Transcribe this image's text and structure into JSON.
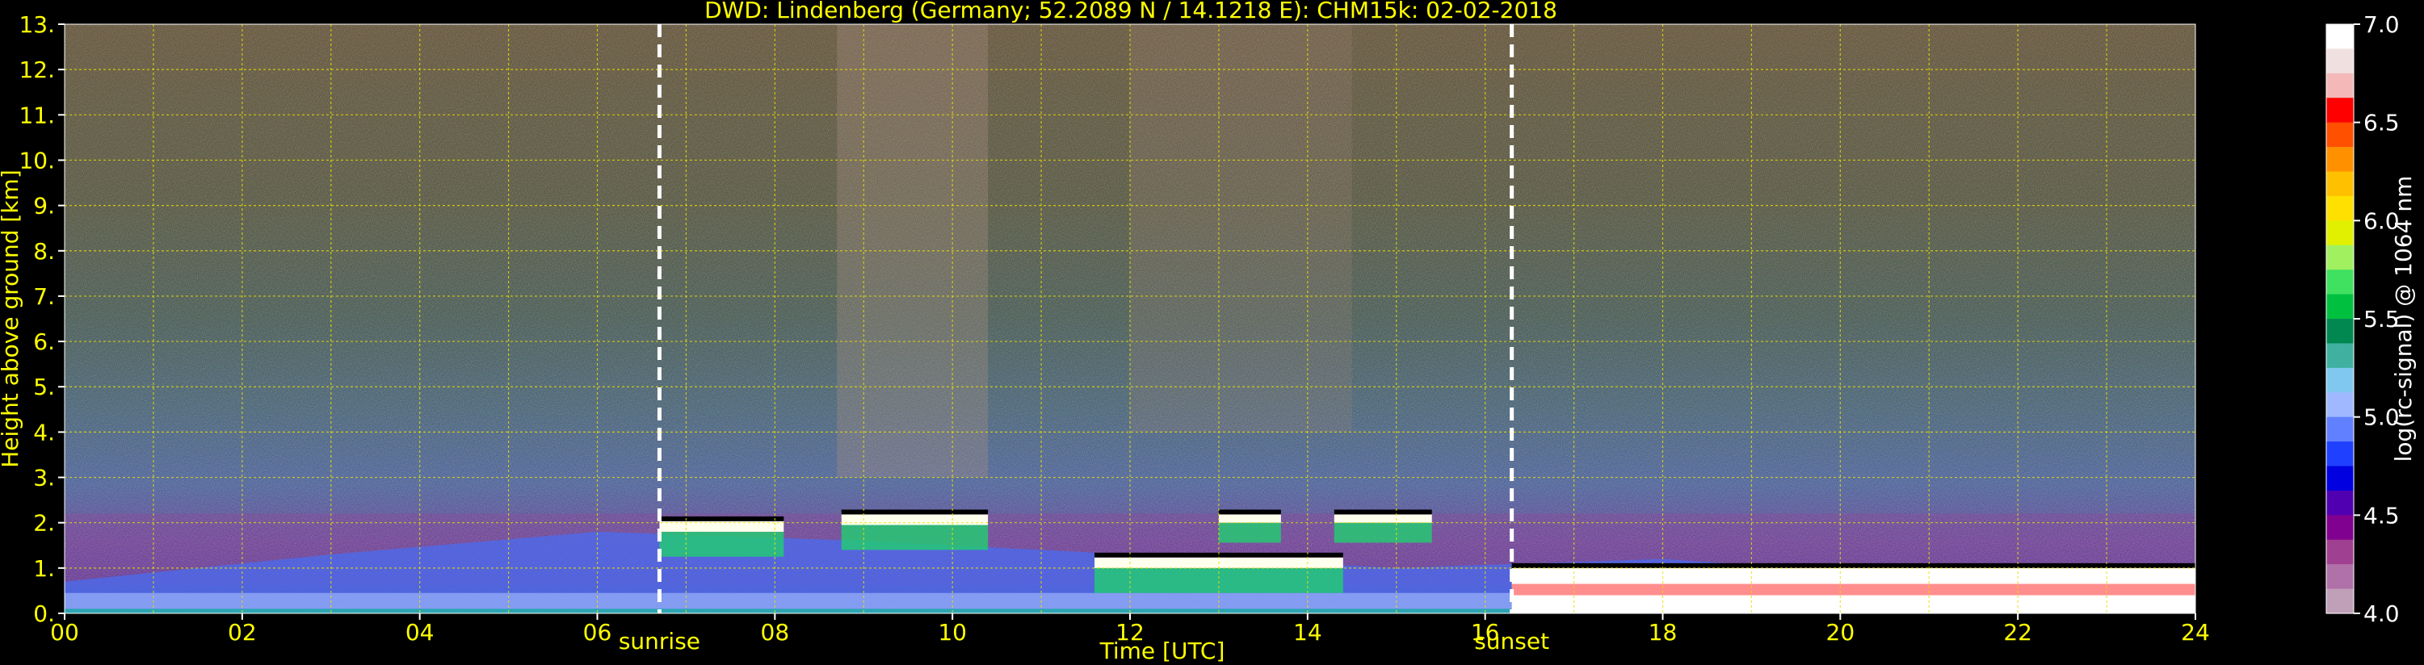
{
  "chart_data": {
    "type": "heatmap",
    "title": "DWD: Lindenberg (Germany; 52.2089 N / 14.1218 E):    CHM15k: 02-02-2018",
    "xlabel": "Time [UTC]",
    "ylabel": "Height above ground [km]",
    "colorbar_label": "log(rc-signal) @ 1064 nm",
    "xlim": [
      0,
      24
    ],
    "ylim": [
      0,
      13
    ],
    "x_ticks": [
      "00",
      "02",
      "04",
      "06",
      "08",
      "10",
      "12",
      "14",
      "16",
      "18",
      "20",
      "22",
      "24"
    ],
    "y_ticks": [
      "0.",
      "1.",
      "2.",
      "3.",
      "4.",
      "5.",
      "6.",
      "7.",
      "8.",
      "9.",
      "10.",
      "11.",
      "12.",
      "13."
    ],
    "colorbar_range": [
      4.0,
      7.0
    ],
    "colorbar_ticks": [
      "4.0",
      "4.5",
      "5.0",
      "5.5",
      "6.0",
      "6.5",
      "7.0"
    ],
    "grid": true,
    "colorscale": [
      "#ffffff",
      "#f0e0e0",
      "#f4b8b8",
      "#ff0000",
      "#ff5000",
      "#ff9000",
      "#ffc000",
      "#ffe000",
      "#e0f000",
      "#a0f060",
      "#40e060",
      "#00c040",
      "#008850",
      "#40b0a0",
      "#80c8f0",
      "#a0b8ff",
      "#6080ff",
      "#2040ff",
      "#0000e0",
      "#5000b0",
      "#800090",
      "#a04090",
      "#b070a8",
      "#c0a0b8"
    ],
    "annotations": [
      {
        "label": "sunrise",
        "x": 6.7
      },
      {
        "label": "sunset",
        "x": 16.3
      }
    ],
    "layers": [
      {
        "kind": "boundary_layer",
        "t_start": 0,
        "t_end": 24,
        "top_km": [
          0.7,
          1.3,
          1.8,
          1.6,
          1.3,
          1.0,
          1.2,
          0.8,
          0.6
        ]
      },
      {
        "kind": "cloud",
        "t_start": 6.7,
        "t_end": 8.1,
        "base_km": 1.8,
        "top_km": 2.05
      },
      {
        "kind": "cloud",
        "t_start": 8.75,
        "t_end": 10.4,
        "base_km": 1.95,
        "top_km": 2.2
      },
      {
        "kind": "cloud",
        "t_start": 11.6,
        "t_end": 14.4,
        "base_km": 1.0,
        "top_km": 1.25
      },
      {
        "kind": "cloud",
        "t_start": 13.0,
        "t_end": 13.7,
        "base_km": 2.0,
        "top_km": 2.2
      },
      {
        "kind": "cloud",
        "t_start": 14.3,
        "t_end": 15.4,
        "base_km": 2.0,
        "top_km": 2.2
      },
      {
        "kind": "cloud",
        "t_start": 16.3,
        "t_end": 24.0,
        "base_km": 0.0,
        "top_km": 1.0
      }
    ]
  }
}
